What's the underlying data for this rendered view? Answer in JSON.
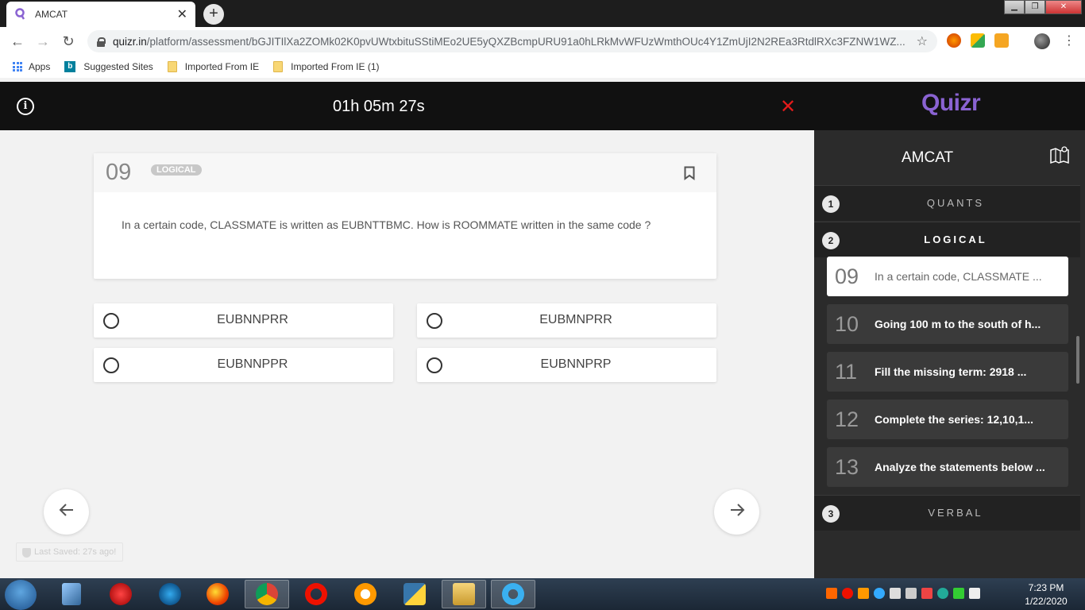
{
  "browser": {
    "tab_title": "AMCAT",
    "url_host": "quizr.in",
    "url_path": "/platform/assessment/bGJITIlXa2ZOMk02K0pvUWtxbituSStiMEo2UE5yQXZBcmpURU91a0hLRkMvWFUzWmthOUc4Y1ZmUjI2N2REa3RtdlRXc3FZNW1WZ...",
    "bookmarks": [
      "Apps",
      "Suggested Sites",
      "Imported From IE",
      "Imported From IE (1)"
    ]
  },
  "header": {
    "timer": "01h 05m 27s"
  },
  "sidebar": {
    "brand": "Quizr",
    "title": "AMCAT",
    "sections": [
      {
        "num": "1",
        "name": "QUANTS"
      },
      {
        "num": "2",
        "name": "LOGICAL"
      },
      {
        "num": "3",
        "name": "VERBAL"
      }
    ],
    "questions": [
      {
        "num": "09",
        "text": "In a certain code, CLASSMATE ...",
        "active": true
      },
      {
        "num": "10",
        "text": "Going 100 m to the south of h..."
      },
      {
        "num": "11",
        "text": "Fill the missing term: 2918 ..."
      },
      {
        "num": "12",
        "text": "Complete the series: 12,10,1..."
      },
      {
        "num": "13",
        "text": "Analyze the statements below ..."
      }
    ]
  },
  "question": {
    "number": "09",
    "category": "LOGICAL",
    "text": "In a certain code, CLASSMATE is written as EUBNTTBMC. How is ROOMMATE written in the same code ?",
    "options": [
      "EUBNNPRR",
      "EUBMNPRR",
      "EUBNNPPR",
      "EUBNNPRP"
    ]
  },
  "status": {
    "last_saved": "Last Saved: 27s ago!"
  },
  "taskbar": {
    "time": "7:23 PM",
    "date": "1/22/2020"
  },
  "colors": {
    "brand": "#8a63d2",
    "close": "#e41b1b"
  }
}
